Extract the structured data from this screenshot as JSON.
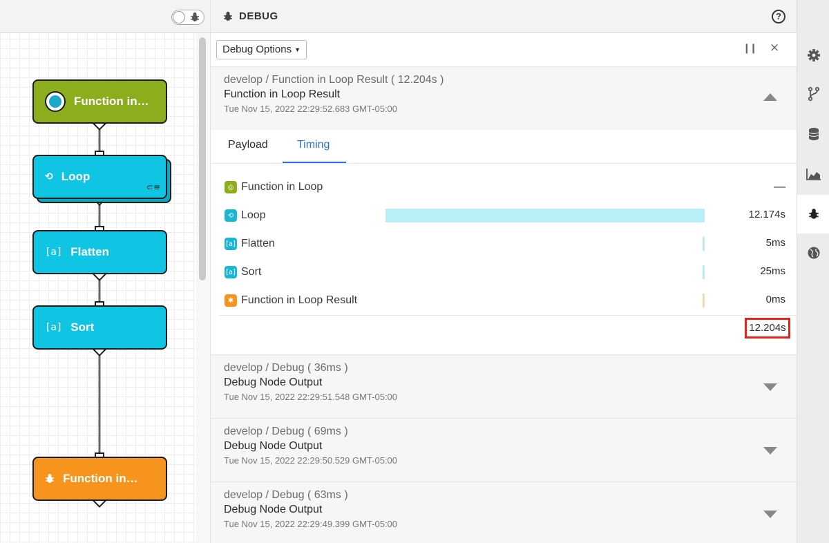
{
  "canvas": {
    "nodes": [
      {
        "label": "Function in…",
        "type": "function-trigger",
        "color": "#8dae1c"
      },
      {
        "label": "Loop",
        "type": "loop",
        "color": "#0fc5e3"
      },
      {
        "label": "Flatten",
        "type": "array",
        "icon_text": "[a]",
        "color": "#0fc5e3"
      },
      {
        "label": "Sort",
        "type": "array",
        "icon_text": "[a]",
        "color": "#0fc5e3"
      },
      {
        "label": "Function in…",
        "type": "debug",
        "color": "#f7941d"
      }
    ]
  },
  "debug_panel": {
    "title": "DEBUG",
    "options_label": "Debug Options",
    "entries": [
      {
        "title": "develop / Function in Loop Result ( 12.204s )",
        "name": "Function in Loop Result",
        "timestamp": "Tue Nov 15, 2022 22:29:52.683 GMT-05:00",
        "expanded": true
      },
      {
        "title": "develop / Debug ( 36ms )",
        "name": "Debug Node Output",
        "timestamp": "Tue Nov 15, 2022 22:29:51.548 GMT-05:00",
        "expanded": false
      },
      {
        "title": "develop / Debug ( 69ms )",
        "name": "Debug Node Output",
        "timestamp": "Tue Nov 15, 2022 22:29:50.529 GMT-05:00",
        "expanded": false
      },
      {
        "title": "develop / Debug ( 63ms )",
        "name": "Debug Node Output",
        "timestamp": "Tue Nov 15, 2022 22:29:49.399 GMT-05:00",
        "expanded": false
      }
    ],
    "tabs": [
      {
        "label": "Payload",
        "active": false
      },
      {
        "label": "Timing",
        "active": true
      }
    ],
    "timing": {
      "rows": [
        {
          "label": "Function in Loop",
          "value": "",
          "icon": "function-icon"
        },
        {
          "label": "Loop",
          "value": "12.174s",
          "icon": "loop-icon",
          "share": 0.9975
        },
        {
          "label": "Flatten",
          "value": "5ms",
          "icon": "array-icon",
          "share": 0.0004
        },
        {
          "label": "Sort",
          "value": "25ms",
          "icon": "array-icon",
          "share": 0.002
        },
        {
          "label": "Function in Loop Result",
          "value": "0ms",
          "icon": "debug-icon",
          "share": 0
        }
      ],
      "total": "12.204s"
    }
  },
  "colors": {
    "accent": "#f7941d",
    "tab_active": "#2e6fd8",
    "timing_bar": "#b9eef5",
    "highlight": "#e3251b"
  }
}
